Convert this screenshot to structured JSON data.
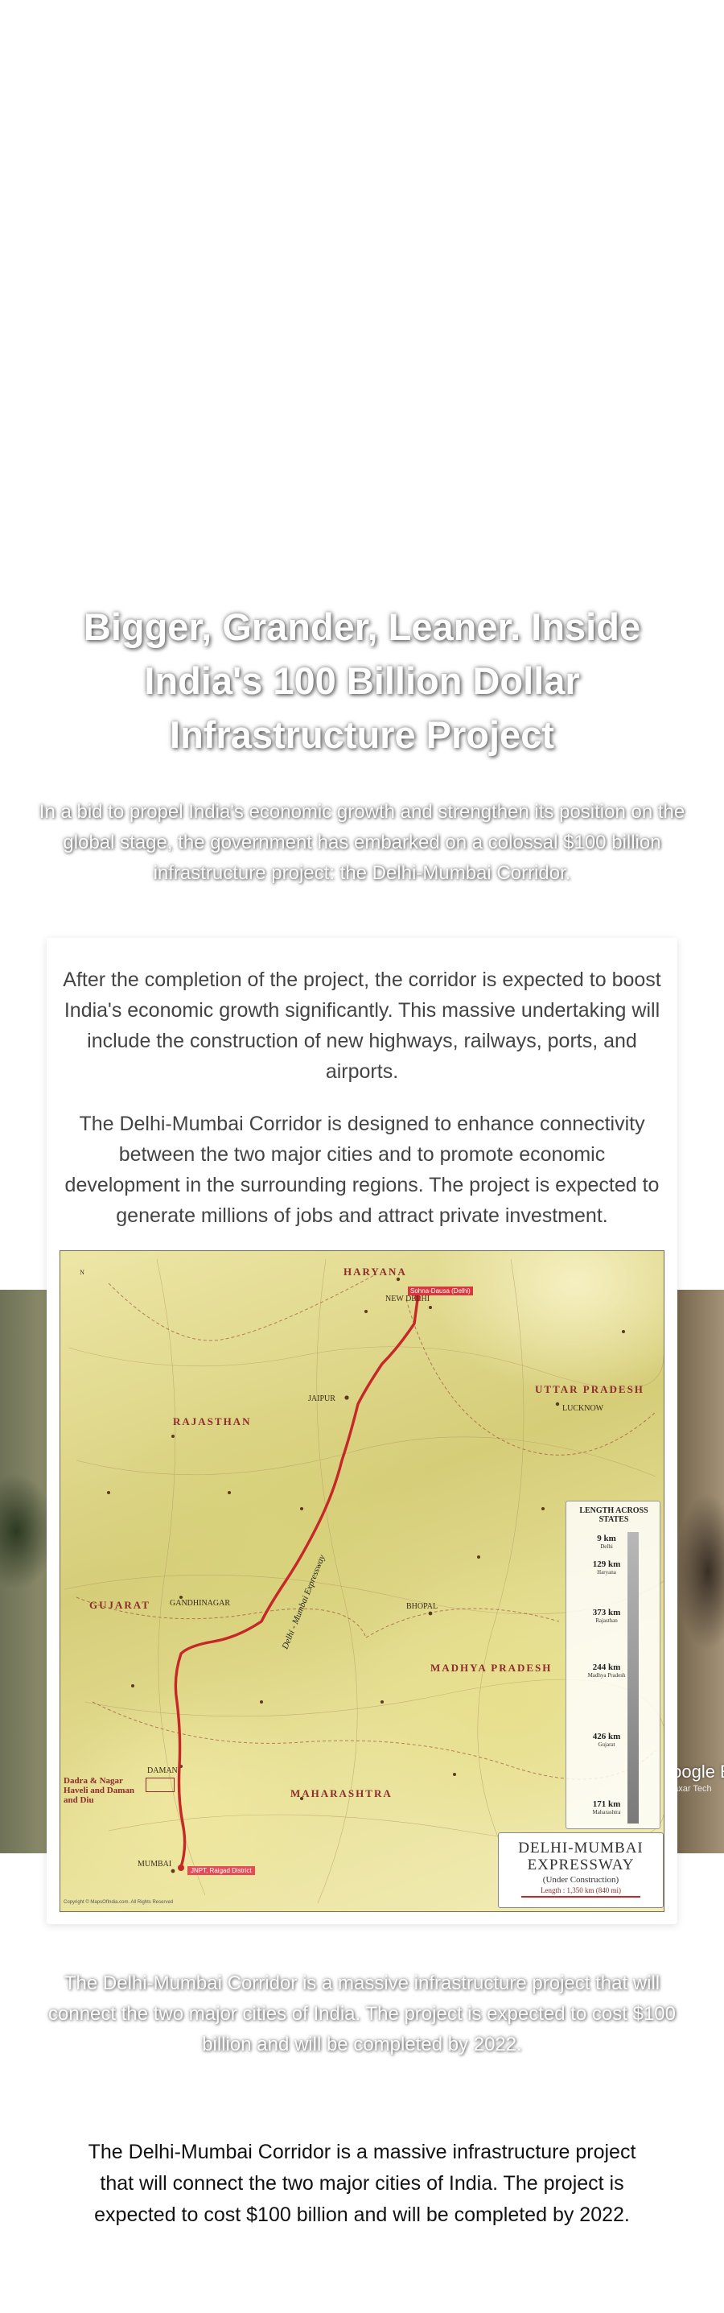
{
  "hero": {
    "title": "Bigger, Grander, Leaner. Inside India's 100 Billion Dollar Infrastructure Project",
    "subtitle": "In a bid to propel India's economic growth and strengthen its position on the global stage, the government has embarked on a colossal $100 billion infrastructure project: the Delhi-Mumbai Corridor."
  },
  "card": {
    "paragraphs": [
      "After the completion of the project, the corridor is expected to boost India's economic growth significantly. This massive undertaking will include the construction of new highways, railways, ports, and airports.",
      "The Delhi-Mumbai Corridor is designed to enhance connectivity between the two major cities and to promote economic development in the surrounding regions. The project is expected to generate millions of jobs and attract private investment."
    ]
  },
  "map": {
    "title_line1": "DELHI-MUMBAI",
    "title_line2": "EXPRESSWAY",
    "status": "(Under Construction)",
    "length": "Length : 1,350 km (840 mi)",
    "start_label": "Sohna-Dausa (Delhi)",
    "end_label": "JNPT, Raigad District",
    "expressway_label": "Delhi - Mumbai Expressway",
    "states": {
      "haryana": "HARYANA",
      "rajasthan": "RAJASTHAN",
      "uttar_pradesh": "UTTAR PRADESH",
      "gujarat": "GUJARAT",
      "madhya_pradesh": "MADHYA PRADESH",
      "maharashtra": "MAHARASHTRA",
      "dadra": "Dadra & Nagar Haveli and Daman and Diu"
    },
    "cities": {
      "delhi": "NEW DELHI",
      "jaipur": "JAIPUR",
      "lucknow": "LUCKNOW",
      "gandhinagar": "GANDHINAGAR",
      "bhopal": "BHOPAL",
      "daman": "DAMAN",
      "mumbai": "MUMBAI"
    },
    "length_table": {
      "heading": "LENGTH ACROSS STATES",
      "segments": [
        {
          "km": "9 km",
          "state": "Delhi"
        },
        {
          "km": "129 km",
          "state": "Haryana"
        },
        {
          "km": "373 km",
          "state": "Rajasthan"
        },
        {
          "km": "244 km",
          "state": "Madhya Pradesh"
        },
        {
          "km": "426 km",
          "state": "Gujarat"
        },
        {
          "km": "171 km",
          "state": "Maharashtra"
        }
      ]
    },
    "compass": "N",
    "copyright": "Copyright © MapsOfIndia.com. All Rights Reserved"
  },
  "overlay": {
    "google_logo": "Google E",
    "google_sub": "Maxar Tech"
  },
  "footer": {
    "shadow_text": "The Delhi-Mumbai Corridor is a massive infrastructure project that will connect the two major cities of India. The project is expected to cost $100 billion and will be completed by 2022.",
    "plain_text": "The Delhi-Mumbai Corridor is a massive infrastructure project that will connect the two major cities of India. The project is expected to cost $100 billion and will be completed by 2022."
  },
  "colors": {
    "route": "#c62828",
    "state_label": "#8c2c2c",
    "body_text": "#444444"
  }
}
